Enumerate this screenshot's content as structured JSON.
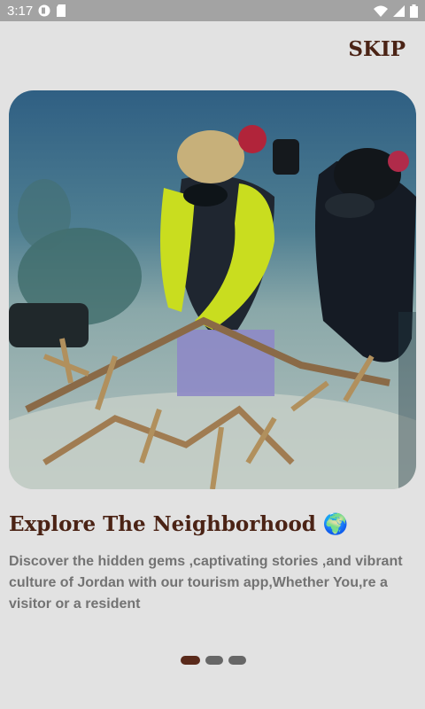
{
  "status_bar": {
    "time": "3:17",
    "icons_left": [
      "app-notification-icon",
      "sd-card-icon"
    ],
    "icons_right": [
      "wifi-icon",
      "signal-icon",
      "battery-icon"
    ]
  },
  "onboarding": {
    "skip_label": "SKIP",
    "image_description_icon": "coral-reef-divers-photo",
    "title": "Explore The Neighborhood 🌍",
    "description": "Discover the hidden gems ,captivating stories ,and vibrant culture of Jordan with our tourism app,Whether You,re a visitor or a resident",
    "page_indicator": {
      "total": 3,
      "active": 0
    }
  },
  "colors": {
    "accent": "#4b2315",
    "background": "#e2e2e2",
    "status_bar": "#a3a3a3",
    "dot_inactive": "#676767",
    "dot_active": "#5a2a1b",
    "description_text": "#737373"
  }
}
